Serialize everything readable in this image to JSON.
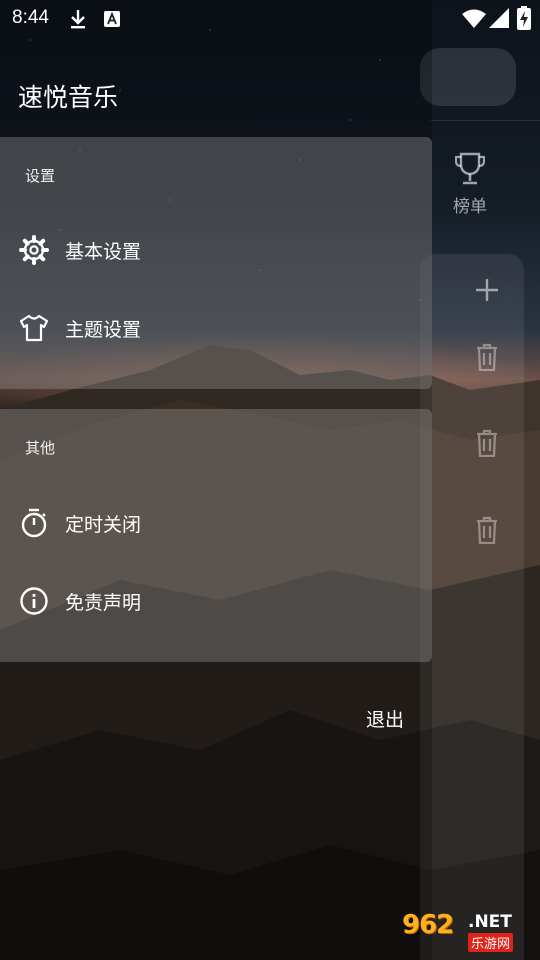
{
  "status_bar": {
    "time": "8:44",
    "icons": [
      "download-icon",
      "a-notification-icon",
      "wifi-icon",
      "signal-icon",
      "battery-charging-icon"
    ]
  },
  "drawer": {
    "app_title": "速悦音乐",
    "sections": [
      {
        "header": "设置",
        "items": [
          {
            "label": "基本设置",
            "icon": "gear-icon"
          },
          {
            "label": "主题设置",
            "icon": "tshirt-icon"
          }
        ]
      },
      {
        "header": "其他",
        "items": [
          {
            "label": "定时关闭",
            "icon": "timer-icon"
          },
          {
            "label": "免责声明",
            "icon": "info-icon"
          }
        ]
      }
    ],
    "exit_label": "退出"
  },
  "background": {
    "rank_label": "榜单",
    "actions": [
      "add-icon",
      "trash-icon",
      "trash-icon",
      "trash-icon"
    ]
  },
  "watermark": {
    "brand_number": "962",
    "brand_suffix": ".NET",
    "brand_sub": "乐游网"
  },
  "colors": {
    "drawer_card": "#8f8f8f",
    "text": "#ffffff",
    "watermark_orange": "#ffb21e",
    "watermark_red": "#e2231a"
  }
}
